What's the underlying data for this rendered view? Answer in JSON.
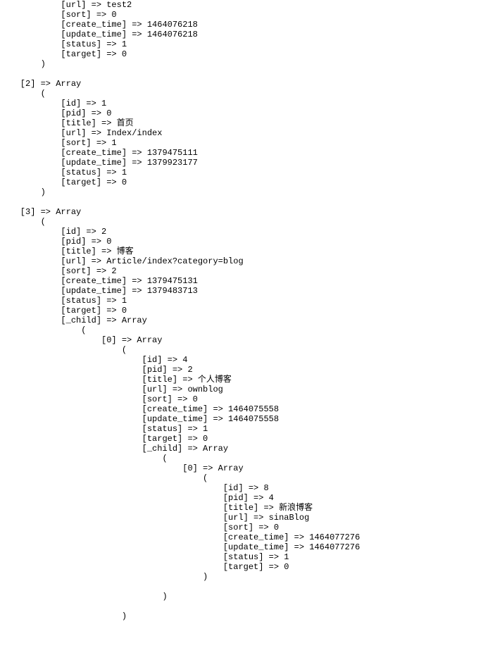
{
  "lines": [
    "            [url] => test2",
    "            [sort] => 0",
    "            [create_time] => 1464076218",
    "            [update_time] => 1464076218",
    "            [status] => 1",
    "            [target] => 0",
    "        )",
    "",
    "    [2] => Array",
    "        (",
    "            [id] => 1",
    "            [pid] => 0",
    "            [title] => 首页",
    "            [url] => Index/index",
    "            [sort] => 1",
    "            [create_time] => 1379475111",
    "            [update_time] => 1379923177",
    "            [status] => 1",
    "            [target] => 0",
    "        )",
    "",
    "    [3] => Array",
    "        (",
    "            [id] => 2",
    "            [pid] => 0",
    "            [title] => 博客",
    "            [url] => Article/index?category=blog",
    "            [sort] => 2",
    "            [create_time] => 1379475131",
    "            [update_time] => 1379483713",
    "            [status] => 1",
    "            [target] => 0",
    "            [_child] => Array",
    "                (",
    "                    [0] => Array",
    "                        (",
    "                            [id] => 4",
    "                            [pid] => 2",
    "                            [title] => 个人博客",
    "                            [url] => ownblog",
    "                            [sort] => 0",
    "                            [create_time] => 1464075558",
    "                            [update_time] => 1464075558",
    "                            [status] => 1",
    "                            [target] => 0",
    "                            [_child] => Array",
    "                                (",
    "                                    [0] => Array",
    "                                        (",
    "                                            [id] => 8",
    "                                            [pid] => 4",
    "                                            [title] => 新浪博客",
    "                                            [url] => sinaBlog",
    "                                            [sort] => 0",
    "                                            [create_time] => 1464077276",
    "                                            [update_time] => 1464077276",
    "                                            [status] => 1",
    "                                            [target] => 0",
    "                                        )",
    "",
    "                                )",
    "",
    "                        )",
    ""
  ]
}
